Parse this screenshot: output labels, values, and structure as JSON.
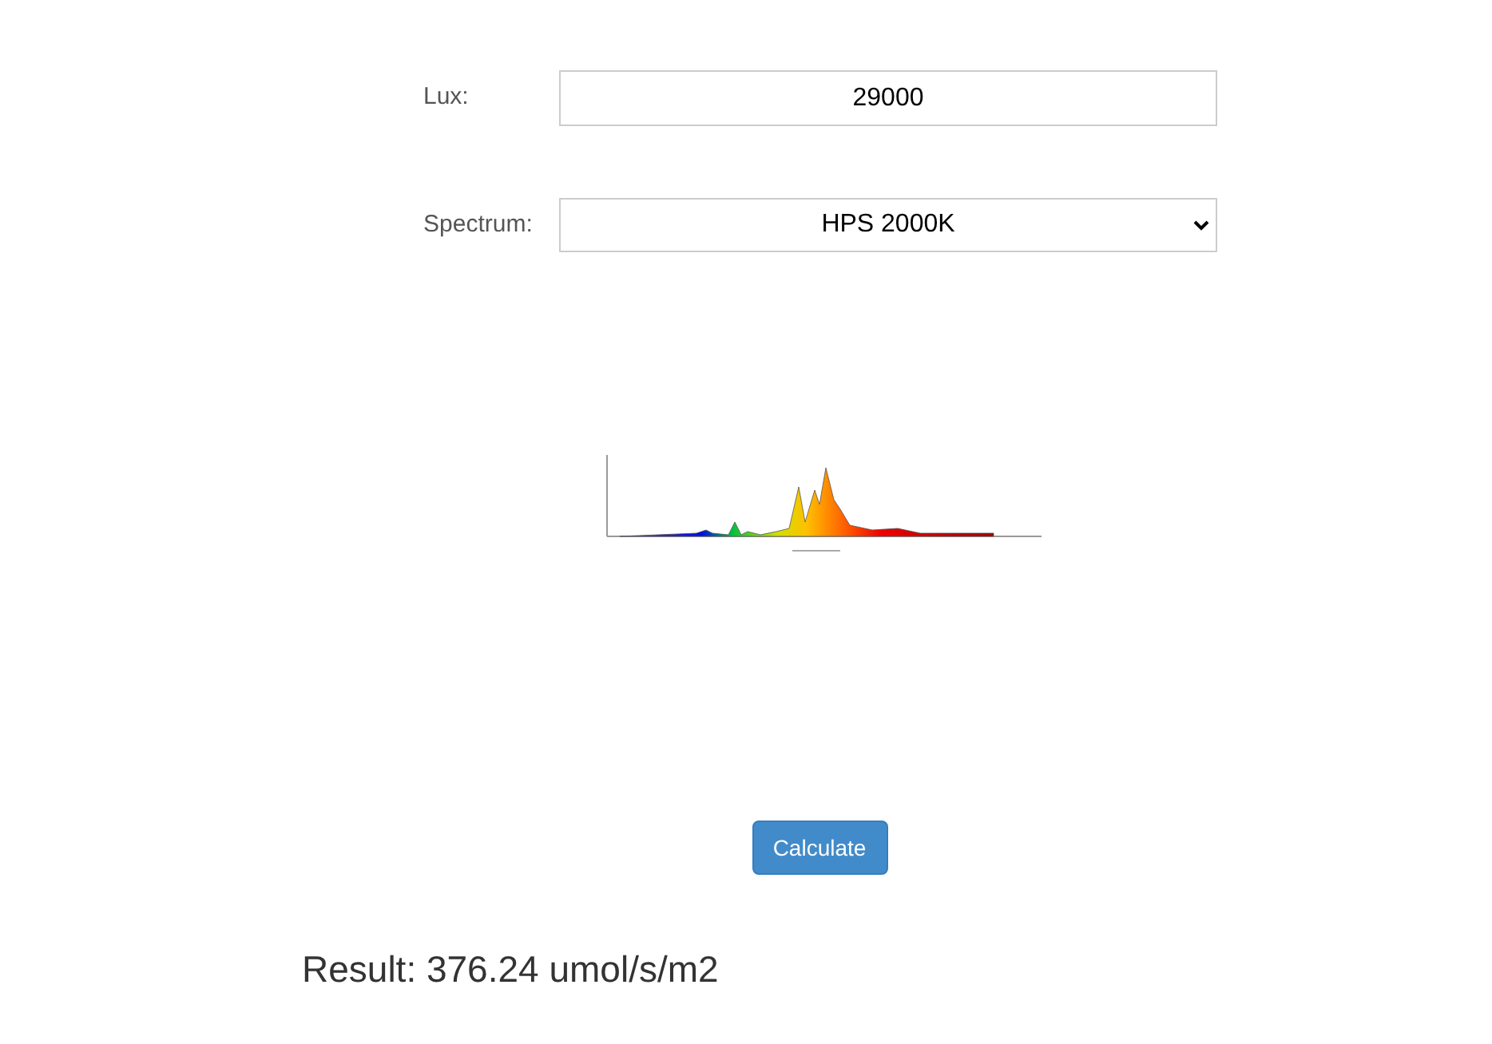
{
  "lux": {
    "label": "Lux:",
    "value": "29000"
  },
  "spectrum": {
    "label": "Spectrum:",
    "value": "HPS 2000K"
  },
  "calculate_button": "Calculate",
  "result": "Result: 376.24 umol/s/m2"
}
